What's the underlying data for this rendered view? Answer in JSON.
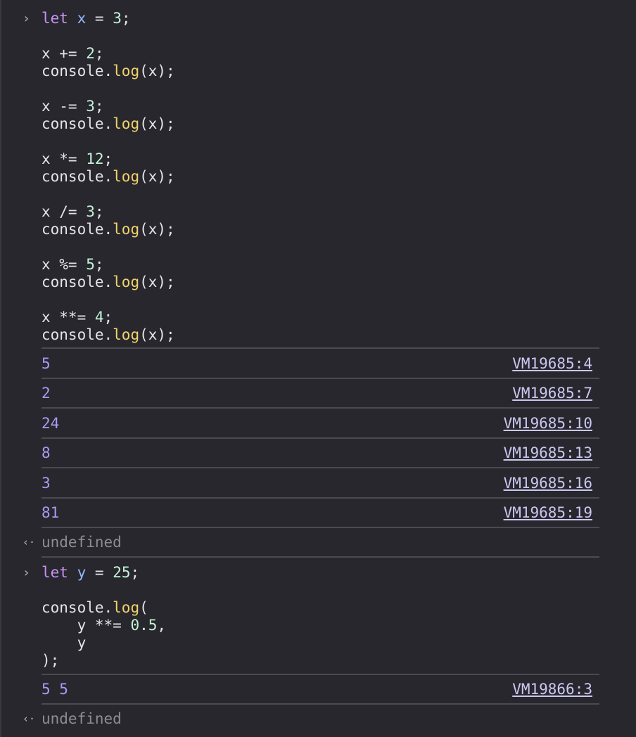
{
  "glyphs": {
    "input_prompt": "›",
    "return_prompt": "‹·"
  },
  "block1": {
    "code": {
      "l1": {
        "kw": "let",
        "var": "x",
        "op": " = ",
        "num": "3",
        "end": ";"
      },
      "l2": {
        "a": "x += ",
        "num": "2",
        "end": ";"
      },
      "l3": {
        "obj": "console.",
        "fn": "log",
        "args": "(x);"
      },
      "l4": {
        "a": "x -= ",
        "num": "3",
        "end": ";"
      },
      "l5": {
        "obj": "console.",
        "fn": "log",
        "args": "(x);"
      },
      "l6": {
        "a": "x *= ",
        "num": "12",
        "end": ";"
      },
      "l7": {
        "obj": "console.",
        "fn": "log",
        "args": "(x);"
      },
      "l8": {
        "a": "x /= ",
        "num": "3",
        "end": ";"
      },
      "l9": {
        "obj": "console.",
        "fn": "log",
        "args": "(x);"
      },
      "l10": {
        "a": "x %= ",
        "num": "5",
        "end": ";"
      },
      "l11": {
        "obj": "console.",
        "fn": "log",
        "args": "(x);"
      },
      "l12": {
        "a": "x **= ",
        "num": "4",
        "end": ";"
      },
      "l13": {
        "obj": "console.",
        "fn": "log",
        "args": "(x);"
      }
    },
    "outputs": [
      {
        "value": "5",
        "source": "VM19685:4"
      },
      {
        "value": "2",
        "source": "VM19685:7"
      },
      {
        "value": "24",
        "source": "VM19685:10"
      },
      {
        "value": "8",
        "source": "VM19685:13"
      },
      {
        "value": "3",
        "source": "VM19685:16"
      },
      {
        "value": "81",
        "source": "VM19685:19"
      }
    ],
    "result": "undefined"
  },
  "block2": {
    "code": {
      "l1": {
        "kw": "let",
        "var": "y",
        "op": " = ",
        "num": "25",
        "end": ";"
      },
      "l2": {
        "obj": "console.",
        "fn": "log",
        "args": "("
      },
      "l3": {
        "a": "    y **= ",
        "num": "0.5",
        "end": ","
      },
      "l4": {
        "a": "    y"
      },
      "l5": {
        "a": ");"
      }
    },
    "outputs": [
      {
        "value": "5 5",
        "source": "VM19866:3"
      }
    ],
    "result": "undefined"
  }
}
